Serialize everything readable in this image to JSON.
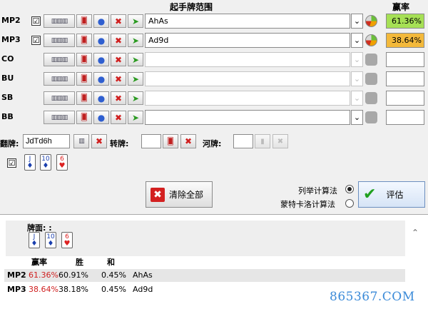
{
  "header": {
    "range_title": "起手牌范围",
    "equity_title": "赢率"
  },
  "players": [
    {
      "pos": "MP2",
      "checked": "☑",
      "range": "AhAs",
      "equity": "61.36%",
      "active": true
    },
    {
      "pos": "MP3",
      "checked": "☑",
      "range": "Ad9d",
      "equity": "38.64%",
      "active": true
    },
    {
      "pos": "CO",
      "checked": "",
      "range": "",
      "equity": "",
      "active": false
    },
    {
      "pos": "BU",
      "checked": "",
      "range": "",
      "equity": "",
      "active": false
    },
    {
      "pos": "SB",
      "checked": "",
      "range": "",
      "equity": "",
      "active": false
    },
    {
      "pos": "BB",
      "checked": "",
      "range": "",
      "equity": "",
      "active": false
    }
  ],
  "board": {
    "flop_label": "翻牌:",
    "flop_value": "JdTd6h",
    "turn_label": "转牌:",
    "river_label": "河牌:",
    "dead_check": "☑",
    "cards": [
      {
        "rank": "J",
        "suit": "♦",
        "color": "#1a3fae"
      },
      {
        "rank": "10",
        "suit": "♦",
        "color": "#1a3fae"
      },
      {
        "rank": "6",
        "suit": "♥",
        "color": "#d22222"
      }
    ]
  },
  "actions": {
    "clear_all": "清除全部",
    "evaluate": "评估",
    "method_enum": "列举计算法",
    "method_monte_carlo": "蒙特卡洛计算法"
  },
  "results": {
    "board_title": "牌面: :",
    "col_equity": "赢率",
    "col_win": "胜",
    "col_tie": "和",
    "rows": [
      {
        "pos": "MP2",
        "equity": "61.36%",
        "win": "60.91%",
        "tie": "0.45%",
        "hand": "AhAs"
      },
      {
        "pos": "MP3",
        "equity": "38.64%",
        "win": "38.18%",
        "tie": "0.45%",
        "hand": "Ad9d"
      }
    ]
  },
  "watermark": "865367.COM",
  "colors": {
    "equity_high": "#a6e055",
    "equity_low": "#f3b93b",
    "accent_red": "#d02020",
    "accent_green": "#2a9a20"
  },
  "icons": [
    "cards-grid-icon",
    "card-icon",
    "chips-icon",
    "close-icon",
    "play-arrow-icon",
    "chevron-down-icon",
    "pie-chart-icon",
    "check-icon"
  ]
}
